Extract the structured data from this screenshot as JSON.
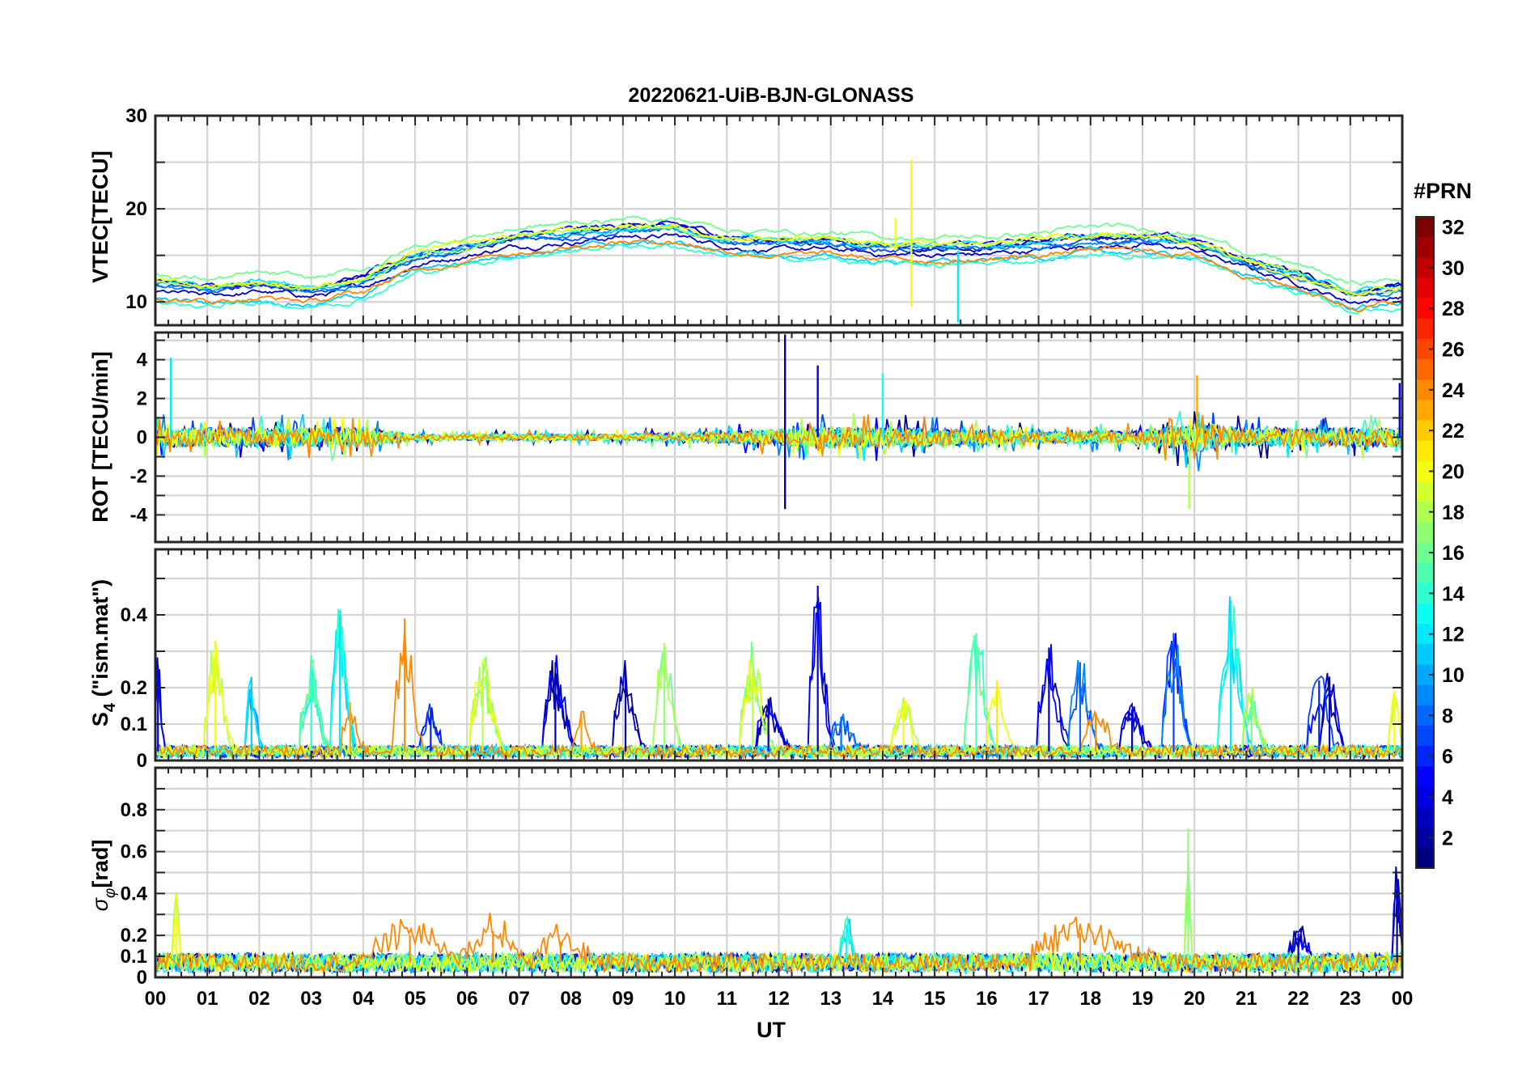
{
  "chart_data": {
    "type": "line",
    "title": "20220621-UiB-BJN-GLONASS",
    "x": {
      "label": "UT",
      "range": [
        0,
        24
      ],
      "tick_values": [
        0,
        1,
        2,
        3,
        4,
        5,
        6,
        7,
        8,
        9,
        10,
        11,
        12,
        13,
        14,
        15,
        16,
        17,
        18,
        19,
        20,
        21,
        22,
        23,
        24
      ],
      "tick_labels": [
        "00",
        "01",
        "02",
        "03",
        "04",
        "05",
        "06",
        "07",
        "08",
        "09",
        "10",
        "11",
        "12",
        "13",
        "14",
        "15",
        "16",
        "17",
        "18",
        "19",
        "20",
        "21",
        "22",
        "23",
        "00"
      ]
    },
    "panels": [
      {
        "id": "vtec",
        "ylabel": "VTEC[TECU]",
        "ylim": [
          7.5,
          30
        ],
        "yticks": [
          10,
          20,
          30
        ],
        "ytick_labels": [
          "10",
          "20",
          "30"
        ],
        "grid_values": [
          10,
          15,
          20,
          25,
          30
        ],
        "profile": [
          [
            0,
            11.5
          ],
          [
            1,
            11.0
          ],
          [
            2,
            11.5
          ],
          [
            3,
            11.0
          ],
          [
            4,
            12.0
          ],
          [
            5,
            14.5
          ],
          [
            6,
            15.5
          ],
          [
            7,
            16.5
          ],
          [
            8,
            17.0
          ],
          [
            9,
            17.5
          ],
          [
            10,
            17.5
          ],
          [
            11,
            16.5
          ],
          [
            12,
            16.0
          ],
          [
            13,
            16.0
          ],
          [
            14,
            15.5
          ],
          [
            15,
            15.5
          ],
          [
            16,
            15.5
          ],
          [
            17,
            16.0
          ],
          [
            18,
            16.5
          ],
          [
            19,
            16.5
          ],
          [
            20,
            16.0
          ],
          [
            21,
            14.0
          ],
          [
            22,
            12.5
          ],
          [
            23,
            10.5
          ],
          [
            24,
            11.0
          ]
        ],
        "spread": 1.5,
        "noise": 0.35,
        "spikes": [
          {
            "x": 14.55,
            "to": 25.3,
            "prn": 20
          },
          {
            "x": 14.55,
            "to": 9.5,
            "prn": 20
          },
          {
            "x": 15.45,
            "to": 7.8,
            "prn": 12
          },
          {
            "x": 14.25,
            "to": 19.0,
            "prn": 20
          }
        ]
      },
      {
        "id": "rot",
        "ylabel": "ROT [TECU/min]",
        "ylim": [
          -5.4,
          5.4
        ],
        "yticks": [
          -4,
          -2,
          0,
          2,
          4
        ],
        "ytick_labels": [
          "-4",
          "-2",
          "0",
          "2",
          "4"
        ],
        "grid_values": [
          -4,
          -3,
          -2,
          -1,
          0,
          1,
          2,
          3,
          4,
          5
        ],
        "profile": [
          [
            0,
            0
          ],
          [
            24,
            0
          ]
        ],
        "amplitude": [
          [
            0,
            0.5
          ],
          [
            4,
            0.5
          ],
          [
            5,
            0.15
          ],
          [
            9,
            0.15
          ],
          [
            11,
            0.3
          ],
          [
            13,
            0.55
          ],
          [
            15,
            0.45
          ],
          [
            17,
            0.3
          ],
          [
            19,
            0.35
          ],
          [
            20,
            0.8
          ],
          [
            21,
            0.45
          ],
          [
            24,
            0.5
          ]
        ],
        "spikes": [
          {
            "x": 12.12,
            "to": 5.3,
            "prn": 2
          },
          {
            "x": 12.12,
            "to": -3.7,
            "prn": 2
          },
          {
            "x": 19.9,
            "to": -3.7,
            "prn": 18
          },
          {
            "x": 20.05,
            "to": 3.2,
            "prn": 23
          },
          {
            "x": 0.3,
            "to": 4.1,
            "prn": 12
          },
          {
            "x": 23.95,
            "to": 2.8,
            "prn": 4
          },
          {
            "x": 12.75,
            "to": 3.7,
            "prn": 4
          },
          {
            "x": 14.0,
            "to": 3.3,
            "prn": 13
          }
        ]
      },
      {
        "id": "s4",
        "ylabel": "S4 (\"ism.mat\")",
        "ylim": [
          0,
          0.58
        ],
        "yticks": [
          0,
          0.1,
          0.2,
          0.4
        ],
        "ytick_labels": [
          "0",
          "0.1",
          "0.2",
          "0.4"
        ],
        "grid_values": [
          0.1,
          0.2,
          0.3,
          0.4,
          0.5
        ],
        "baseline": 0.025,
        "bursts": [
          {
            "x": 0.05,
            "peak": 0.26,
            "width": 0.15,
            "prn": 4
          },
          {
            "x": 1.15,
            "peak": 0.33,
            "width": 0.35,
            "prn": 20
          },
          {
            "x": 1.85,
            "peak": 0.23,
            "width": 0.2,
            "prn": 11
          },
          {
            "x": 3.0,
            "peak": 0.26,
            "width": 0.35,
            "prn": 14
          },
          {
            "x": 3.55,
            "peak": 0.4,
            "width": 0.3,
            "prn": 12
          },
          {
            "x": 3.75,
            "peak": 0.16,
            "width": 0.3,
            "prn": 23
          },
          {
            "x": 4.8,
            "peak": 0.39,
            "width": 0.35,
            "prn": 24
          },
          {
            "x": 5.3,
            "peak": 0.14,
            "width": 0.3,
            "prn": 6
          },
          {
            "x": 6.3,
            "peak": 0.27,
            "width": 0.4,
            "prn": 18
          },
          {
            "x": 7.7,
            "peak": 0.27,
            "width": 0.4,
            "prn": 3
          },
          {
            "x": 8.2,
            "peak": 0.12,
            "width": 0.3,
            "prn": 23
          },
          {
            "x": 9.05,
            "peak": 0.25,
            "width": 0.4,
            "prn": 2
          },
          {
            "x": 9.8,
            "peak": 0.31,
            "width": 0.35,
            "prn": 17
          },
          {
            "x": 11.5,
            "peak": 0.29,
            "width": 0.4,
            "prn": 18
          },
          {
            "x": 11.8,
            "peak": 0.17,
            "width": 0.4,
            "prn": 3
          },
          {
            "x": 12.75,
            "peak": 0.48,
            "width": 0.3,
            "prn": 4
          },
          {
            "x": 13.2,
            "peak": 0.12,
            "width": 0.4,
            "prn": 8
          },
          {
            "x": 14.4,
            "peak": 0.16,
            "width": 0.35,
            "prn": 20
          },
          {
            "x": 15.8,
            "peak": 0.35,
            "width": 0.4,
            "prn": 15
          },
          {
            "x": 16.2,
            "peak": 0.22,
            "width": 0.3,
            "prn": 21
          },
          {
            "x": 17.2,
            "peak": 0.31,
            "width": 0.4,
            "prn": 4
          },
          {
            "x": 17.8,
            "peak": 0.27,
            "width": 0.4,
            "prn": 8
          },
          {
            "x": 18.1,
            "peak": 0.13,
            "width": 0.5,
            "prn": 24
          },
          {
            "x": 18.8,
            "peak": 0.14,
            "width": 0.4,
            "prn": 3
          },
          {
            "x": 19.6,
            "peak": 0.35,
            "width": 0.35,
            "prn": 7
          },
          {
            "x": 20.7,
            "peak": 0.44,
            "width": 0.4,
            "prn": 12
          },
          {
            "x": 21.1,
            "peak": 0.18,
            "width": 0.3,
            "prn": 16
          },
          {
            "x": 22.4,
            "peak": 0.22,
            "width": 0.4,
            "prn": 6
          },
          {
            "x": 22.6,
            "peak": 0.23,
            "width": 0.3,
            "prn": 3
          },
          {
            "x": 23.85,
            "peak": 0.19,
            "width": 0.2,
            "prn": 20
          }
        ]
      },
      {
        "id": "sigma",
        "ylabel": "σφ[rad]",
        "ylim": [
          0,
          1.0
        ],
        "yticks": [
          0,
          0.1,
          0.2,
          0.4,
          0.6,
          0.8
        ],
        "ytick_labels": [
          "0",
          "0.1",
          "0.2",
          "0.4",
          "0.6",
          "0.8"
        ],
        "grid_values": [
          0.1,
          0.2,
          0.3,
          0.4,
          0.5,
          0.6,
          0.7,
          0.8,
          0.9
        ],
        "baseline": 0.07,
        "bursts": [
          {
            "x": 0.4,
            "peak": 0.39,
            "width": 0.12,
            "prn": 20
          },
          {
            "x": 4.9,
            "peak": 0.2,
            "width": 1.4,
            "prn": 24
          },
          {
            "x": 6.5,
            "peak": 0.22,
            "width": 0.8,
            "prn": 24
          },
          {
            "x": 7.8,
            "peak": 0.17,
            "width": 0.8,
            "prn": 24
          },
          {
            "x": 13.3,
            "peak": 0.22,
            "width": 0.2,
            "prn": 13
          },
          {
            "x": 17.8,
            "peak": 0.21,
            "width": 1.6,
            "prn": 24
          },
          {
            "x": 19.88,
            "peak": 0.71,
            "width": 0.1,
            "prn": 17
          },
          {
            "x": 22.0,
            "peak": 0.21,
            "width": 0.3,
            "prn": 3
          },
          {
            "x": 23.9,
            "peak": 0.47,
            "width": 0.15,
            "prn": 3
          }
        ]
      }
    ],
    "series": [
      {
        "prn": 1
      },
      {
        "prn": 3
      },
      {
        "prn": 5
      },
      {
        "prn": 7
      },
      {
        "prn": 9
      },
      {
        "prn": 11
      },
      {
        "prn": 12
      },
      {
        "prn": 14
      },
      {
        "prn": 16
      },
      {
        "prn": 18
      },
      {
        "prn": 20
      },
      {
        "prn": 24
      }
    ],
    "colorbar": {
      "title": "#PRN",
      "range": [
        1,
        32
      ],
      "colormap": "jet",
      "ticks": [
        "32",
        "30",
        "28",
        "26",
        "24",
        "22",
        "20",
        "18",
        "16",
        "14",
        "12",
        "10",
        "8",
        "6",
        "4",
        "2"
      ]
    },
    "grid": true
  }
}
